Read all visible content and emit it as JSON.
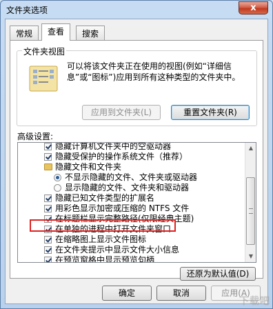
{
  "window": {
    "title": "文件夹选项",
    "close_glyph": "x"
  },
  "tabs": [
    {
      "label": "常规",
      "active": false
    },
    {
      "label": "查看",
      "active": true
    },
    {
      "label": "搜索",
      "active": false
    }
  ],
  "folder_views": {
    "title": "文件夹视图",
    "description": "可以将该文件夹正在使用的视图(例如“详细信息”或“图标”)应用到所有这种类型的文件夹中。",
    "apply_button": "应用到文件夹(L)",
    "reset_button": "重置文件夹(R)"
  },
  "advanced": {
    "label": "高级设置:",
    "items": [
      {
        "type": "checkbox",
        "checked": true,
        "indent": 0,
        "label": "隐藏计算机文件夹中的空驱动器"
      },
      {
        "type": "checkbox",
        "checked": true,
        "indent": 0,
        "label": "隐藏受保护的操作系统文件（推荐）"
      },
      {
        "type": "folder",
        "indent": 0,
        "label": "隐藏文件和文件夹"
      },
      {
        "type": "radio",
        "selected": true,
        "indent": 1,
        "label": "不显示隐藏的文件、文件夹或驱动器"
      },
      {
        "type": "radio",
        "selected": false,
        "indent": 1,
        "label": "显示隐藏的文件、文件夹和驱动器"
      },
      {
        "type": "checkbox",
        "checked": true,
        "indent": 0,
        "label": "隐藏已知文件类型的扩展名"
      },
      {
        "type": "checkbox",
        "checked": true,
        "indent": 0,
        "label": "用彩色显示加密或压缩的 NTFS 文件"
      },
      {
        "type": "checkbox",
        "checked": true,
        "indent": 0,
        "label": "在标题栏显示完整路径(仅限经典主题)"
      },
      {
        "type": "checkbox",
        "checked": true,
        "indent": 0,
        "label": "在单独的进程中打开文件夹窗口",
        "highlighted": true
      },
      {
        "type": "checkbox",
        "checked": true,
        "indent": 0,
        "label": "在缩略图上显示文件图标"
      },
      {
        "type": "checkbox",
        "checked": true,
        "indent": 0,
        "label": "在文件夹提示中显示文件大小信息"
      },
      {
        "type": "checkbox",
        "checked": true,
        "indent": 0,
        "label": "在预览窗格中显示预览句柄"
      }
    ],
    "restore_button": "还原为默认值(D)"
  },
  "footer": {
    "ok_button": "确定",
    "cancel_button": "取消",
    "apply_button": "应用(A)"
  },
  "watermark": "下载吧",
  "colors": {
    "highlight_border": "#e02020",
    "close_button": "#c9452a",
    "titlebar": "#bfd6ef"
  }
}
